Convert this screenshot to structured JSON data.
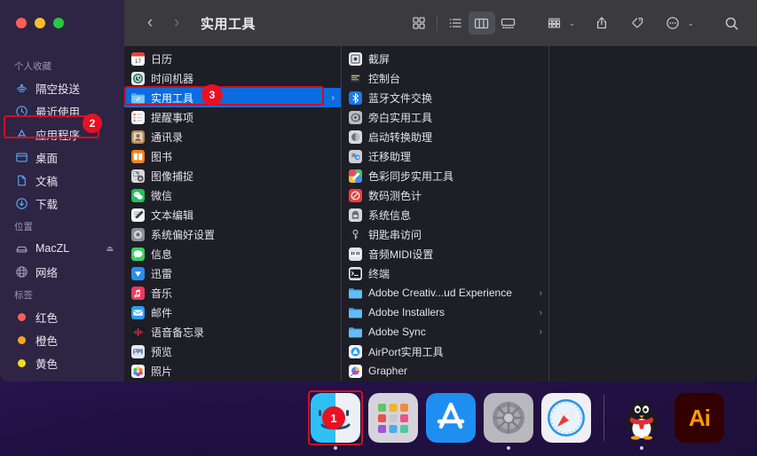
{
  "window": {
    "title": "实用工具",
    "traffic_lights": [
      "close",
      "minimize",
      "zoom"
    ],
    "nav": {
      "back": "‹",
      "forward": "›"
    }
  },
  "toolbar": {
    "icon_view": "icon-view-icon",
    "list_view": "list-view-icon",
    "column_view": "column-view-icon",
    "gallery_view": "gallery-view-icon",
    "group_by": "group-by-icon",
    "group_by_chevron": "⌄",
    "share": "share-icon",
    "tag": "tag-icon",
    "more": "more-actions-icon",
    "more_chevron": "⌄",
    "search": "search-icon"
  },
  "sidebar": {
    "sections": [
      {
        "header": "个人收藏",
        "items": [
          {
            "label": "隔空投送",
            "icon": "airdrop-icon"
          },
          {
            "label": "最近使用",
            "icon": "recents-clock-icon"
          },
          {
            "label": "应用程序",
            "icon": "applications-icon",
            "annotated": true
          },
          {
            "label": "桌面",
            "icon": "desktop-icon"
          },
          {
            "label": "文稿",
            "icon": "documents-icon"
          },
          {
            "label": "下载",
            "icon": "downloads-icon"
          }
        ]
      },
      {
        "header": "位置",
        "items": [
          {
            "label": "MacZL",
            "icon": "hard-disk-icon",
            "eject": "⏏"
          },
          {
            "label": "网络",
            "icon": "network-globe-icon"
          }
        ]
      },
      {
        "header": "标签",
        "items": [
          {
            "label": "红色",
            "icon": "tag-dot-icon",
            "color": "#ff5f57"
          },
          {
            "label": "橙色",
            "icon": "tag-dot-icon",
            "color": "#f5a623"
          },
          {
            "label": "黄色",
            "icon": "tag-dot-icon",
            "color": "#f5d923"
          }
        ]
      }
    ]
  },
  "columns": [
    {
      "name": "applications-column",
      "items": [
        {
          "label": "日历",
          "icon": "calendar-icon",
          "arrow": false
        },
        {
          "label": "时间机器",
          "icon": "time-machine-icon",
          "arrow": false
        },
        {
          "label": "实用工具",
          "icon": "folder-utilities-icon",
          "arrow": true,
          "selected": true,
          "annotated": true
        },
        {
          "label": "提醒事项",
          "icon": "reminders-icon",
          "arrow": false
        },
        {
          "label": "通讯录",
          "icon": "contacts-icon",
          "arrow": false
        },
        {
          "label": "图书",
          "icon": "books-icon",
          "arrow": false
        },
        {
          "label": "图像捕捉",
          "icon": "image-capture-icon",
          "arrow": false
        },
        {
          "label": "微信",
          "icon": "wechat-icon",
          "arrow": false
        },
        {
          "label": "文本编辑",
          "icon": "textedit-icon",
          "arrow": false
        },
        {
          "label": "系统偏好设置",
          "icon": "system-preferences-icon",
          "arrow": false
        },
        {
          "label": "信息",
          "icon": "messages-icon",
          "arrow": false
        },
        {
          "label": "迅雷",
          "icon": "thunder-icon",
          "arrow": false
        },
        {
          "label": "音乐",
          "icon": "music-icon",
          "arrow": false
        },
        {
          "label": "邮件",
          "icon": "mail-icon",
          "arrow": false
        },
        {
          "label": "语音备忘录",
          "icon": "voice-memos-icon",
          "arrow": false
        },
        {
          "label": "预览",
          "icon": "preview-icon",
          "arrow": false
        },
        {
          "label": "照片",
          "icon": "photos-icon",
          "arrow": false
        }
      ]
    },
    {
      "name": "utilities-column",
      "items": [
        {
          "label": "截屏",
          "icon": "screenshot-icon",
          "arrow": false
        },
        {
          "label": "控制台",
          "icon": "console-icon",
          "arrow": false
        },
        {
          "label": "蓝牙文件交换",
          "icon": "bluetooth-icon",
          "arrow": false
        },
        {
          "label": "旁白实用工具",
          "icon": "voiceover-utility-icon",
          "arrow": false
        },
        {
          "label": "启动转换助理",
          "icon": "boot-camp-icon",
          "arrow": false
        },
        {
          "label": "迁移助理",
          "icon": "migration-assistant-icon",
          "arrow": false
        },
        {
          "label": "色彩同步实用工具",
          "icon": "colorsync-utility-icon",
          "arrow": false
        },
        {
          "label": "数码测色计",
          "icon": "digital-color-meter-icon",
          "arrow": false
        },
        {
          "label": "系统信息",
          "icon": "system-information-icon",
          "arrow": false
        },
        {
          "label": "钥匙串访问",
          "icon": "keychain-access-icon",
          "arrow": false
        },
        {
          "label": "音频MIDI设置",
          "icon": "audio-midi-setup-icon",
          "arrow": false
        },
        {
          "label": "终端",
          "icon": "terminal-icon",
          "arrow": false
        },
        {
          "label": "Adobe Creativ...ud Experience",
          "icon": "folder-icon",
          "arrow": true
        },
        {
          "label": "Adobe Installers",
          "icon": "folder-icon",
          "arrow": true
        },
        {
          "label": "Adobe Sync",
          "icon": "folder-icon",
          "arrow": true
        },
        {
          "label": "AirPort实用工具",
          "icon": "airport-utility-icon",
          "arrow": false
        },
        {
          "label": "Grapher",
          "icon": "grapher-icon",
          "arrow": false
        }
      ]
    },
    {
      "name": "preview-column",
      "items": []
    }
  ],
  "annotations": [
    {
      "id": "1",
      "target": "dock-finder"
    },
    {
      "id": "2",
      "target": "sidebar-applications"
    },
    {
      "id": "3",
      "target": "column-item-utilities"
    }
  ],
  "dock": {
    "items": [
      {
        "label": "访达",
        "icon": "finder-icon",
        "running": true,
        "annotated": true,
        "badge": "1"
      },
      {
        "label": "启动台",
        "icon": "launchpad-icon",
        "running": false
      },
      {
        "label": "App Store",
        "icon": "app-store-icon",
        "running": false
      },
      {
        "label": "系统偏好设置",
        "icon": "system-preferences-icon",
        "running": true
      },
      {
        "label": "Safari 浏览器",
        "icon": "safari-icon",
        "running": false
      },
      {
        "separator": true
      },
      {
        "label": "QQ",
        "icon": "qq-penguin-icon",
        "running": true
      },
      {
        "label": "Adobe Illustrator",
        "icon": "illustrator-icon",
        "running": false,
        "text": "Ai"
      }
    ]
  },
  "colors": {
    "selection_blue": "#0a6ce0",
    "annotation_red": "#cf1020",
    "badge_red": "#e81123",
    "sidebar_bg": "#2e2544",
    "content_bg": "#1e1e26",
    "titlebar_bg": "#3a3a3f"
  }
}
